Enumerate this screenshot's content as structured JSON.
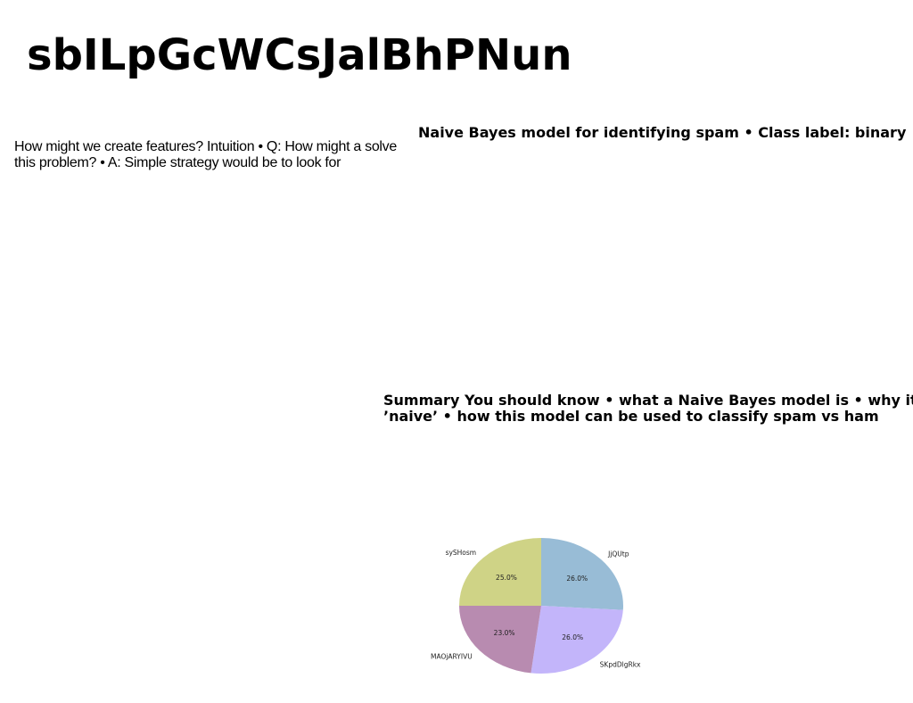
{
  "page": {
    "title": "sbILpGcWCsJalBhPNun",
    "left_text": "How might we create features? Intuition • Q: How might a solve this problem? • A: Simple strategy would be to look for",
    "right_heading": "Naive Bayes model for identifying spam • Class label: binary",
    "summary_line1": "Summary You should know • what a Naive Bayes model is • why it",
    "summary_line2": "’naive’ • how this model can be used to classify spam vs ham"
  },
  "chart_data": {
    "type": "pie",
    "labels": [
      "JjQUtp",
      "SKpdDlgRkx",
      "MAOjARYIVU",
      "sySHosm"
    ],
    "values": [
      26.0,
      26.0,
      23.0,
      25.0
    ],
    "pct_labels": [
      "26.0%",
      "26.0%",
      "23.0%",
      "25.0%"
    ],
    "colors": [
      "#98bcd6",
      "#c3b5fa",
      "#b88bb0",
      "#cfd386"
    ],
    "start_angle_deg": 90,
    "direction": "clockwise"
  }
}
